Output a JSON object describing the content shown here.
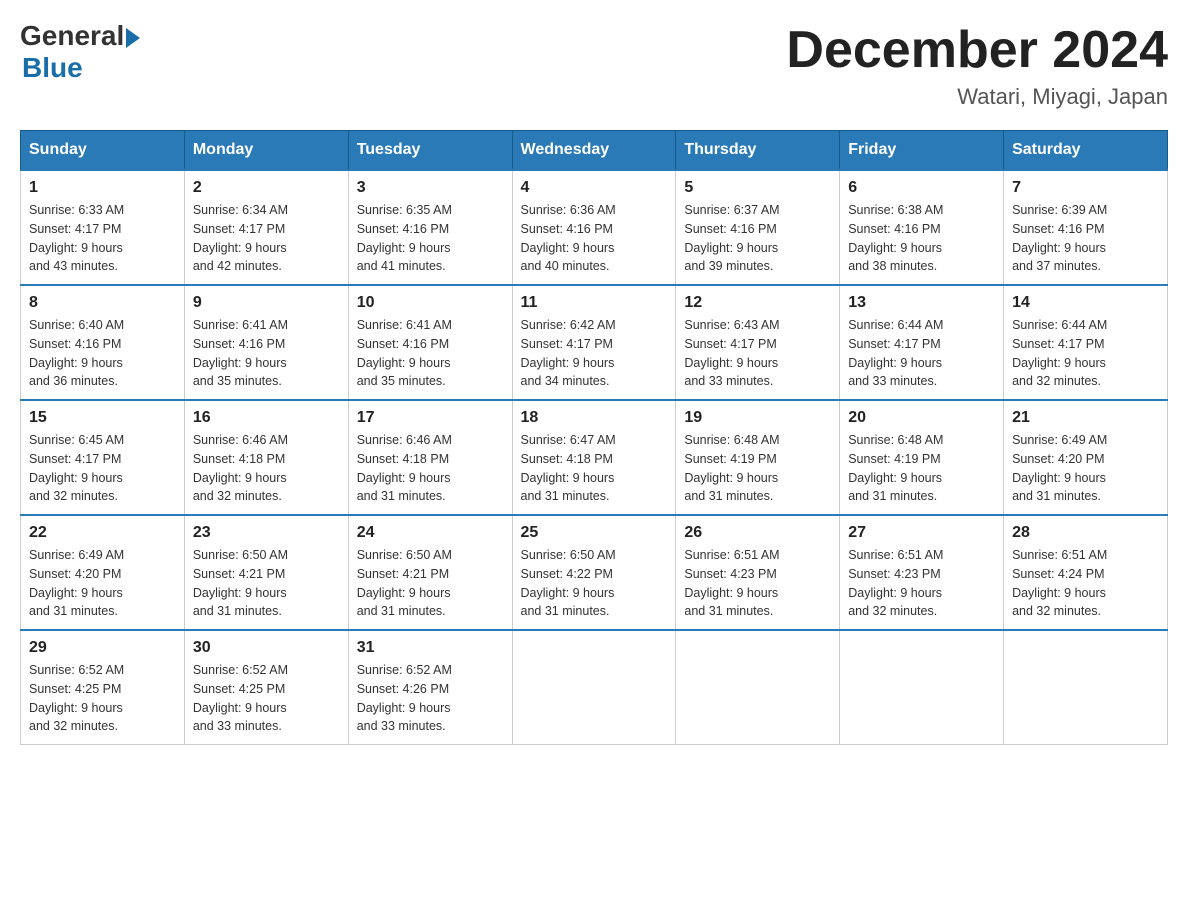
{
  "logo": {
    "general": "General",
    "blue": "Blue"
  },
  "title": "December 2024",
  "subtitle": "Watari, Miyagi, Japan",
  "days_of_week": [
    "Sunday",
    "Monday",
    "Tuesday",
    "Wednesday",
    "Thursday",
    "Friday",
    "Saturday"
  ],
  "weeks": [
    [
      {
        "day": "1",
        "sunrise": "6:33 AM",
        "sunset": "4:17 PM",
        "daylight": "9 hours and 43 minutes."
      },
      {
        "day": "2",
        "sunrise": "6:34 AM",
        "sunset": "4:17 PM",
        "daylight": "9 hours and 42 minutes."
      },
      {
        "day": "3",
        "sunrise": "6:35 AM",
        "sunset": "4:16 PM",
        "daylight": "9 hours and 41 minutes."
      },
      {
        "day": "4",
        "sunrise": "6:36 AM",
        "sunset": "4:16 PM",
        "daylight": "9 hours and 40 minutes."
      },
      {
        "day": "5",
        "sunrise": "6:37 AM",
        "sunset": "4:16 PM",
        "daylight": "9 hours and 39 minutes."
      },
      {
        "day": "6",
        "sunrise": "6:38 AM",
        "sunset": "4:16 PM",
        "daylight": "9 hours and 38 minutes."
      },
      {
        "day": "7",
        "sunrise": "6:39 AM",
        "sunset": "4:16 PM",
        "daylight": "9 hours and 37 minutes."
      }
    ],
    [
      {
        "day": "8",
        "sunrise": "6:40 AM",
        "sunset": "4:16 PM",
        "daylight": "9 hours and 36 minutes."
      },
      {
        "day": "9",
        "sunrise": "6:41 AM",
        "sunset": "4:16 PM",
        "daylight": "9 hours and 35 minutes."
      },
      {
        "day": "10",
        "sunrise": "6:41 AM",
        "sunset": "4:16 PM",
        "daylight": "9 hours and 35 minutes."
      },
      {
        "day": "11",
        "sunrise": "6:42 AM",
        "sunset": "4:17 PM",
        "daylight": "9 hours and 34 minutes."
      },
      {
        "day": "12",
        "sunrise": "6:43 AM",
        "sunset": "4:17 PM",
        "daylight": "9 hours and 33 minutes."
      },
      {
        "day": "13",
        "sunrise": "6:44 AM",
        "sunset": "4:17 PM",
        "daylight": "9 hours and 33 minutes."
      },
      {
        "day": "14",
        "sunrise": "6:44 AM",
        "sunset": "4:17 PM",
        "daylight": "9 hours and 32 minutes."
      }
    ],
    [
      {
        "day": "15",
        "sunrise": "6:45 AM",
        "sunset": "4:17 PM",
        "daylight": "9 hours and 32 minutes."
      },
      {
        "day": "16",
        "sunrise": "6:46 AM",
        "sunset": "4:18 PM",
        "daylight": "9 hours and 32 minutes."
      },
      {
        "day": "17",
        "sunrise": "6:46 AM",
        "sunset": "4:18 PM",
        "daylight": "9 hours and 31 minutes."
      },
      {
        "day": "18",
        "sunrise": "6:47 AM",
        "sunset": "4:18 PM",
        "daylight": "9 hours and 31 minutes."
      },
      {
        "day": "19",
        "sunrise": "6:48 AM",
        "sunset": "4:19 PM",
        "daylight": "9 hours and 31 minutes."
      },
      {
        "day": "20",
        "sunrise": "6:48 AM",
        "sunset": "4:19 PM",
        "daylight": "9 hours and 31 minutes."
      },
      {
        "day": "21",
        "sunrise": "6:49 AM",
        "sunset": "4:20 PM",
        "daylight": "9 hours and 31 minutes."
      }
    ],
    [
      {
        "day": "22",
        "sunrise": "6:49 AM",
        "sunset": "4:20 PM",
        "daylight": "9 hours and 31 minutes."
      },
      {
        "day": "23",
        "sunrise": "6:50 AM",
        "sunset": "4:21 PM",
        "daylight": "9 hours and 31 minutes."
      },
      {
        "day": "24",
        "sunrise": "6:50 AM",
        "sunset": "4:21 PM",
        "daylight": "9 hours and 31 minutes."
      },
      {
        "day": "25",
        "sunrise": "6:50 AM",
        "sunset": "4:22 PM",
        "daylight": "9 hours and 31 minutes."
      },
      {
        "day": "26",
        "sunrise": "6:51 AM",
        "sunset": "4:23 PM",
        "daylight": "9 hours and 31 minutes."
      },
      {
        "day": "27",
        "sunrise": "6:51 AM",
        "sunset": "4:23 PM",
        "daylight": "9 hours and 32 minutes."
      },
      {
        "day": "28",
        "sunrise": "6:51 AM",
        "sunset": "4:24 PM",
        "daylight": "9 hours and 32 minutes."
      }
    ],
    [
      {
        "day": "29",
        "sunrise": "6:52 AM",
        "sunset": "4:25 PM",
        "daylight": "9 hours and 32 minutes."
      },
      {
        "day": "30",
        "sunrise": "6:52 AM",
        "sunset": "4:25 PM",
        "daylight": "9 hours and 33 minutes."
      },
      {
        "day": "31",
        "sunrise": "6:52 AM",
        "sunset": "4:26 PM",
        "daylight": "9 hours and 33 minutes."
      },
      null,
      null,
      null,
      null
    ]
  ],
  "labels": {
    "sunrise": "Sunrise:",
    "sunset": "Sunset:",
    "daylight": "Daylight:"
  }
}
